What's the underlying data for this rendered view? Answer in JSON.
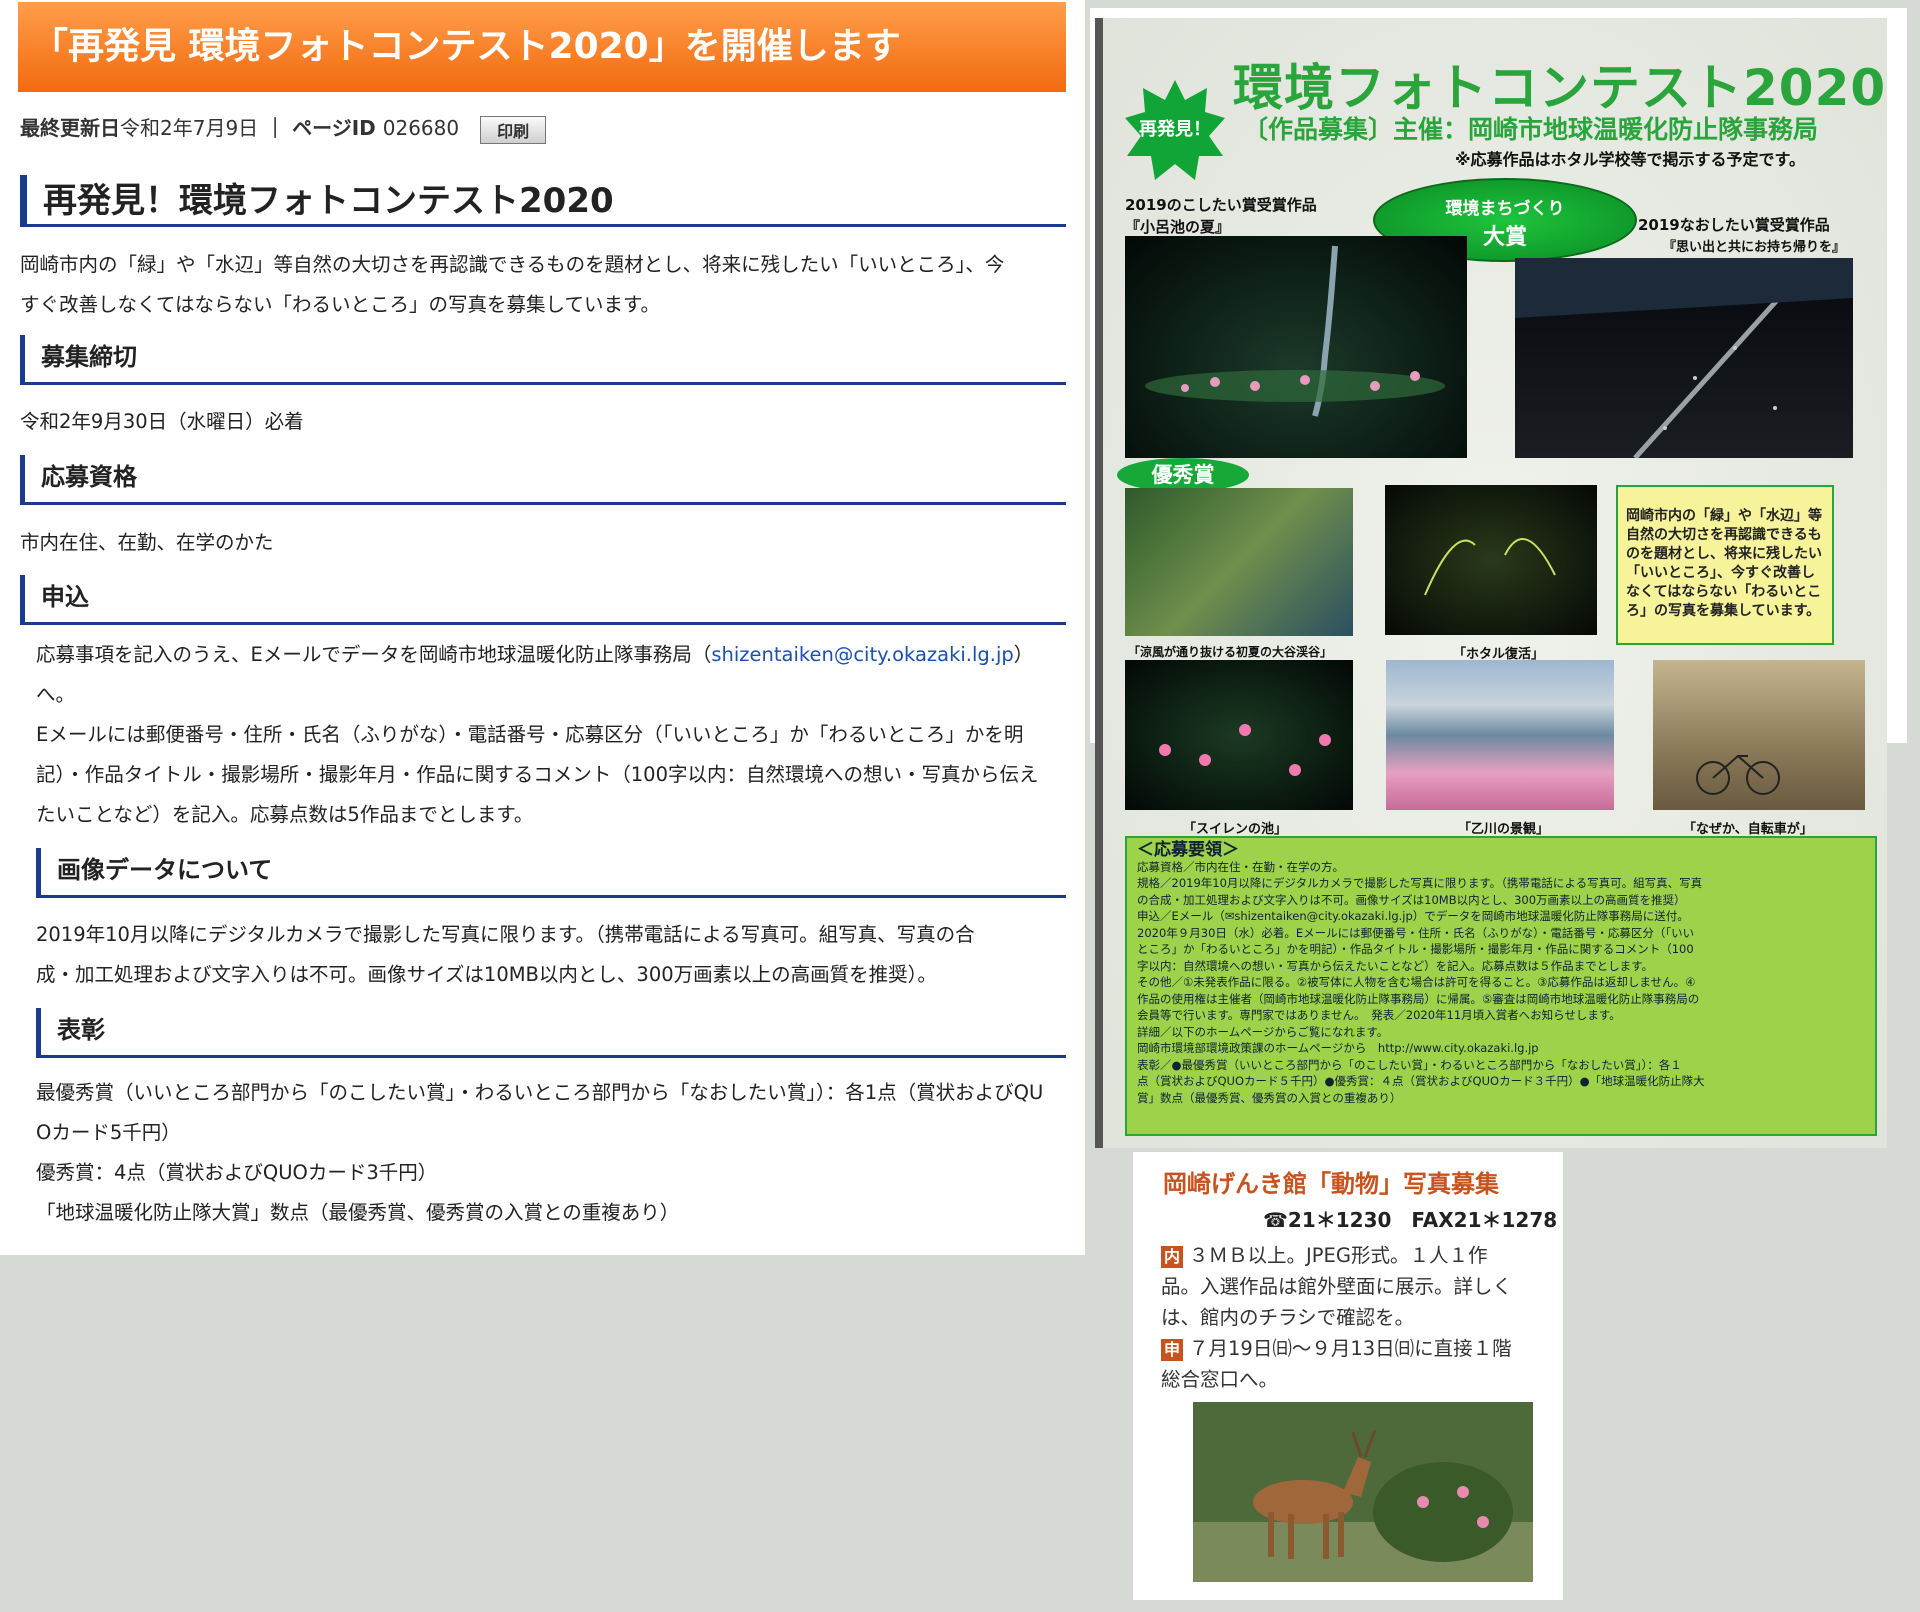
{
  "page": {
    "title": "「再発見 環境フォトコンテスト2020」を開催します",
    "meta_updated_label": "最終更新日",
    "meta_updated_date": "令和2年7月9日",
    "meta_separator": "｜",
    "meta_page_id_label": "ページID",
    "meta_page_id": "026680",
    "print_label": "印刷",
    "heading": "再発見！環境フォトコンテスト2020",
    "intro": [
      "岡崎市内の「緑」や「水辺」等自然の大切さを再認識できるものを題材とし、将来に残したい「いいところ」、今",
      "すぐ改善しなくてはならない「わるいところ」の写真を募集しています。"
    ],
    "sections": [
      {
        "heading": "募集締切",
        "lines": [
          "令和2年9月30日（水曜日）必着"
        ]
      },
      {
        "heading": "応募資格",
        "lines": [
          "市内在住、在勤、在学のかた"
        ]
      },
      {
        "heading": "申込",
        "line1_prefix": "応募事項を記入のうえ、Eメールでデータを岡崎市地球温暖化防止隊事務局（",
        "email": "shizentaiken@city.okazaki.lg.jp",
        "line1_suffix": "）",
        "lines": [
          "へ。",
          "Eメールには郵便番号・住所・氏名（ふりがな）・電話番号・応募区分（「いいところ」か「わるいところ」かを明",
          "記）・作品タイトル・撮影場所・撮影年月・作品に関するコメント（100字以内：自然環境への想い・写真から伝え",
          "たいことなど）を記入。応募点数は5作品までとします。"
        ]
      },
      {
        "heading": "画像データについて",
        "lines": [
          "2019年10月以降にデジタルカメラで撮影した写真に限ります。（携帯電話による写真可。組写真、写真の合",
          "成・加工処理および文字入りは不可。画像サイズは10MB以内とし、300万画素以上の高画質を推奨）。"
        ]
      },
      {
        "heading": "表彰",
        "lines": [
          "最優秀賞（いいところ部門から「のこしたい賞」・わるいところ部門から「なおしたい賞」）：各1点（賞状およびQU",
          "Oカード5千円）",
          "優秀賞：4点（賞状およびQUOカード3千円）",
          "「地球温暖化防止隊大賞」数点（最優秀賞、優秀賞の入賞との重複あり）"
        ]
      }
    ]
  },
  "poster": {
    "badge": "再発見！",
    "title": "環境フォトコンテスト2020",
    "subtitle": "〔作品募集〕主催：岡崎市地球温暖化防止隊事務局",
    "note": "※応募作品はホタル学校等で掲示する予定です。",
    "grand_prize_line1": "環境まちづくり",
    "grand_prize_line2": "大賞",
    "left_winner_caption1": "2019のこしたい賞受賞作品",
    "left_winner_caption2": "『小呂池の夏』",
    "right_winner_caption1": "2019なおしたい賞受賞作品",
    "right_winner_caption2": "『思い出と共にお持ち帰りを』",
    "award_label": "優秀賞",
    "captions": [
      "「涼風が通り抜ける初夏の大谷渓谷」",
      "「ホタル復活」",
      "「スイレンの池」",
      "「乙川の景観」",
      "「なぜか、自転車が」"
    ],
    "yellow_box": "岡崎市内の「緑」や「水辺」等自然の大切さを再認識できるものを題材とし、将来に残したい「いいところ」、今すぐ改善しなくてはならない「わるいところ」の写真を募集しています。",
    "guide_title": "＜応募要領＞",
    "guide_lines": [
      "応募資格／市内在住・在勤・在学の方。",
      "規格／2019年10月以降にデジタルカメラで撮影した写真に限ります。（携帯電話による写真可。組写真、写真",
      "の合成・加工処理および文字入りは不可。画像サイズは10MB以内とし、300万画素以上の高画質を推奨）",
      "申込／Eメール（✉shizentaiken@city.okazaki.lg.jp）でデータを岡崎市地球温暖化防止隊事務局に送付。",
      "2020年９月30日（水）必着。Eメールには郵便番号・住所・氏名（ふりがな）・電話番号・応募区分（「いい",
      "ところ」か「わるいところ」かを明記）・作品タイトル・撮影場所・撮影年月・作品に関するコメント（100",
      "字以内：自然環境への想い・写真から伝えたいことなど）を記入。応募点数は５作品までとします。",
      "その他／①未発表作品に限る。②被写体に人物を含む場合は許可を得ること。③応募作品は返却しません。④",
      "作品の使用権は主催者（岡崎市地球温暖化防止隊事務局）に帰属。⑤審査は岡崎市地球温暖化防止隊事務局の",
      "会員等で行います。専門家ではありません。　発表／2020年11月頃入賞者へお知らせします。",
      "詳細／以下のホームページからご覧になれます。",
      "岡崎市環境部環境政策課のホームページから　http://www.city.okazaki.lg.jp",
      "表彰／●最優秀賞（いいところ部門から「のこしたい賞」・わるいところ部門から「なおしたい賞」）：各１",
      "点（賞状およびQUOカード５千円）●優秀賞：４点（賞状およびQUOカード３千円）●「地球温暖化防止隊大",
      "賞」数点（最優秀賞、優秀賞の入賞との重複あり）"
    ]
  },
  "flyer": {
    "title": "岡崎げんき館「動物」写真募集",
    "tel": "☎21＊1230　FAX21＊1278",
    "tag1": "内",
    "text1": "３ＭＢ以上。JPEG形式。１人１作品。入選作品は館外壁面に展示。詳しくは、館内のチラシで確認を。",
    "tag2": "申",
    "text2": "７月19日㈰～９月13日㈰に直接１階総合窓口へ。"
  }
}
